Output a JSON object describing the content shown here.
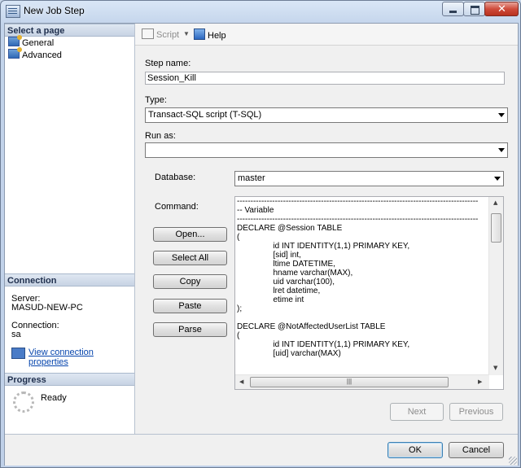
{
  "window": {
    "title": "New Job Step"
  },
  "left_pane": {
    "select_page_header": "Select a page",
    "pages": [
      {
        "label": "General",
        "icon": "page-icon"
      },
      {
        "label": "Advanced",
        "icon": "page-icon"
      }
    ],
    "connection": {
      "header": "Connection",
      "server_label": "Server:",
      "server_value": "MASUD-NEW-PC",
      "connection_label": "Connection:",
      "connection_value": "sa",
      "view_properties_link": "View connection properties"
    },
    "progress": {
      "header": "Progress",
      "status": "Ready"
    }
  },
  "toolbar": {
    "script_label": "Script",
    "help_label": "Help"
  },
  "form": {
    "step_name_label": "Step name:",
    "step_name_value": "Session_Kill",
    "type_label": "Type:",
    "type_value": "Transact-SQL script (T-SQL)",
    "run_as_label": "Run as:",
    "run_as_value": "",
    "database_label": "Database:",
    "database_value": "master",
    "command_label": "Command:",
    "command_text": "-----------------------------------------------------------------------------------------\n-- Variable\n-----------------------------------------------------------------------------------------\nDECLARE @Session TABLE\n(\n                id INT IDENTITY(1,1) PRIMARY KEY,\n                [sid] int,\n                ltime DATETIME,\n                hname varchar(MAX),\n                uid varchar(100),\n                lret datetime,\n                etime int\n);\n\nDECLARE @NotAffectedUserList TABLE\n(\n                id INT IDENTITY(1,1) PRIMARY KEY,\n                [uid] varchar(MAX)"
  },
  "buttons": {
    "open": "Open...",
    "select_all": "Select All",
    "copy": "Copy",
    "paste": "Paste",
    "parse": "Parse",
    "next": "Next",
    "previous": "Previous",
    "ok": "OK",
    "cancel": "Cancel"
  },
  "colors": {
    "link": "#0645ad",
    "pane_header": "#c7d3e4",
    "close_button": "#cf4b3b"
  }
}
